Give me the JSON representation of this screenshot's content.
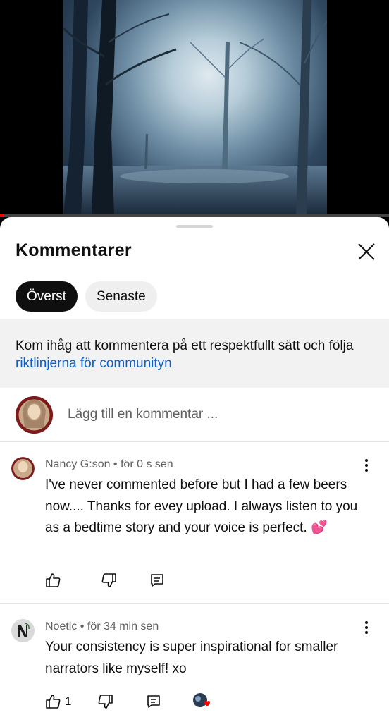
{
  "sheet": {
    "title": "Kommentarer",
    "chips": [
      {
        "label": "Överst",
        "active": true
      },
      {
        "label": "Senaste",
        "active": false
      }
    ],
    "notice": {
      "text": "Kom ihåg att kommentera på ett respektfullt sätt och följa ",
      "link": "riktlinjerna för communityn"
    },
    "add_comment": {
      "placeholder": "Lägg till en kommentar ..."
    }
  },
  "comments": [
    {
      "author": "Nancy G:son",
      "time": "för 0 s sen",
      "meta": "Nancy G:son • för 0 s sen",
      "text": "I've never commented before but I had a few beers now.... Thanks for evey upload. I always listen to you as a bedtime story and your voice is perfect. 💕",
      "likes": ""
    },
    {
      "author": "Noetic",
      "time": "för 34 min sen",
      "meta": "Noetic • för 34 min sen",
      "text": "Your consistency is super inspirational for smaller narrators like myself! xo",
      "likes": "1",
      "creator_heart": true
    }
  ],
  "colors": {
    "link": "#065fd4",
    "active_chip": "#0f0f0f",
    "progress": "#ff0000"
  },
  "icons": [
    "close-icon",
    "like-icon",
    "dislike-icon",
    "reply-icon",
    "more-vert-icon",
    "creator-heart-icon"
  ]
}
